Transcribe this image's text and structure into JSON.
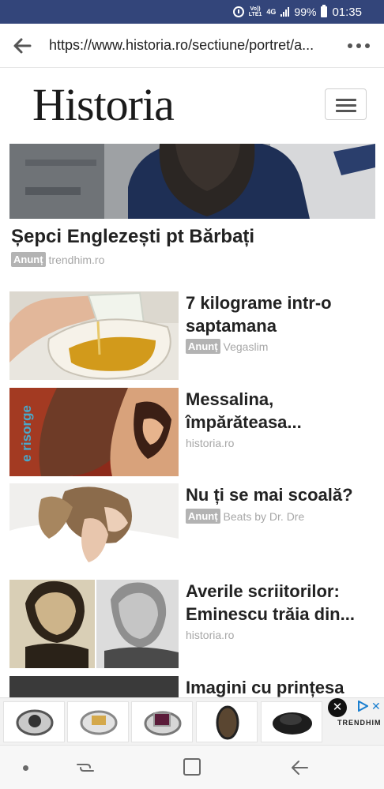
{
  "status_bar": {
    "volte_top": "Vo))",
    "volte_bottom": "LTE1",
    "network": "4G",
    "battery": "99%",
    "time": "01:35",
    "color": "#33457a"
  },
  "browser": {
    "url": "https://www.historia.ro/sectiune/portret/a...",
    "back_icon": "arrow-left-icon",
    "menu_icon": "more-dots-icon"
  },
  "site": {
    "logo": "Historia",
    "menu_icon": "hamburger-icon"
  },
  "hero": {
    "title": "Șepci Englezești pt Bărbați",
    "badge": "Anunț",
    "source": "trendhim.ro"
  },
  "articles": [
    {
      "title": "7 kilograme intr-o saptamana",
      "badge": "Anunț",
      "source": "Vegaslim"
    },
    {
      "title": "Messalina, împărăteasa...",
      "badge": "",
      "source": "historia.ro",
      "thumb_overlay_text": "e risorge"
    },
    {
      "title": "Nu ți se mai scoală?",
      "badge": "Anunț",
      "source": "Beats by Dr. Dre"
    },
    {
      "title": "Averile scriitorilor: Eminescu trăia din...",
      "badge": "",
      "source": "historia.ro"
    },
    {
      "title": "Imagini cu prințesa",
      "badge": "",
      "source": ""
    }
  ],
  "ad": {
    "close_label": "✕",
    "adchoices_x": "✕",
    "brand": "TRENDHIM"
  },
  "nav_bar": {
    "home_icon": "home-square-icon",
    "back_icon": "back-arrow-icon",
    "recents_icon": "recents-icon"
  }
}
